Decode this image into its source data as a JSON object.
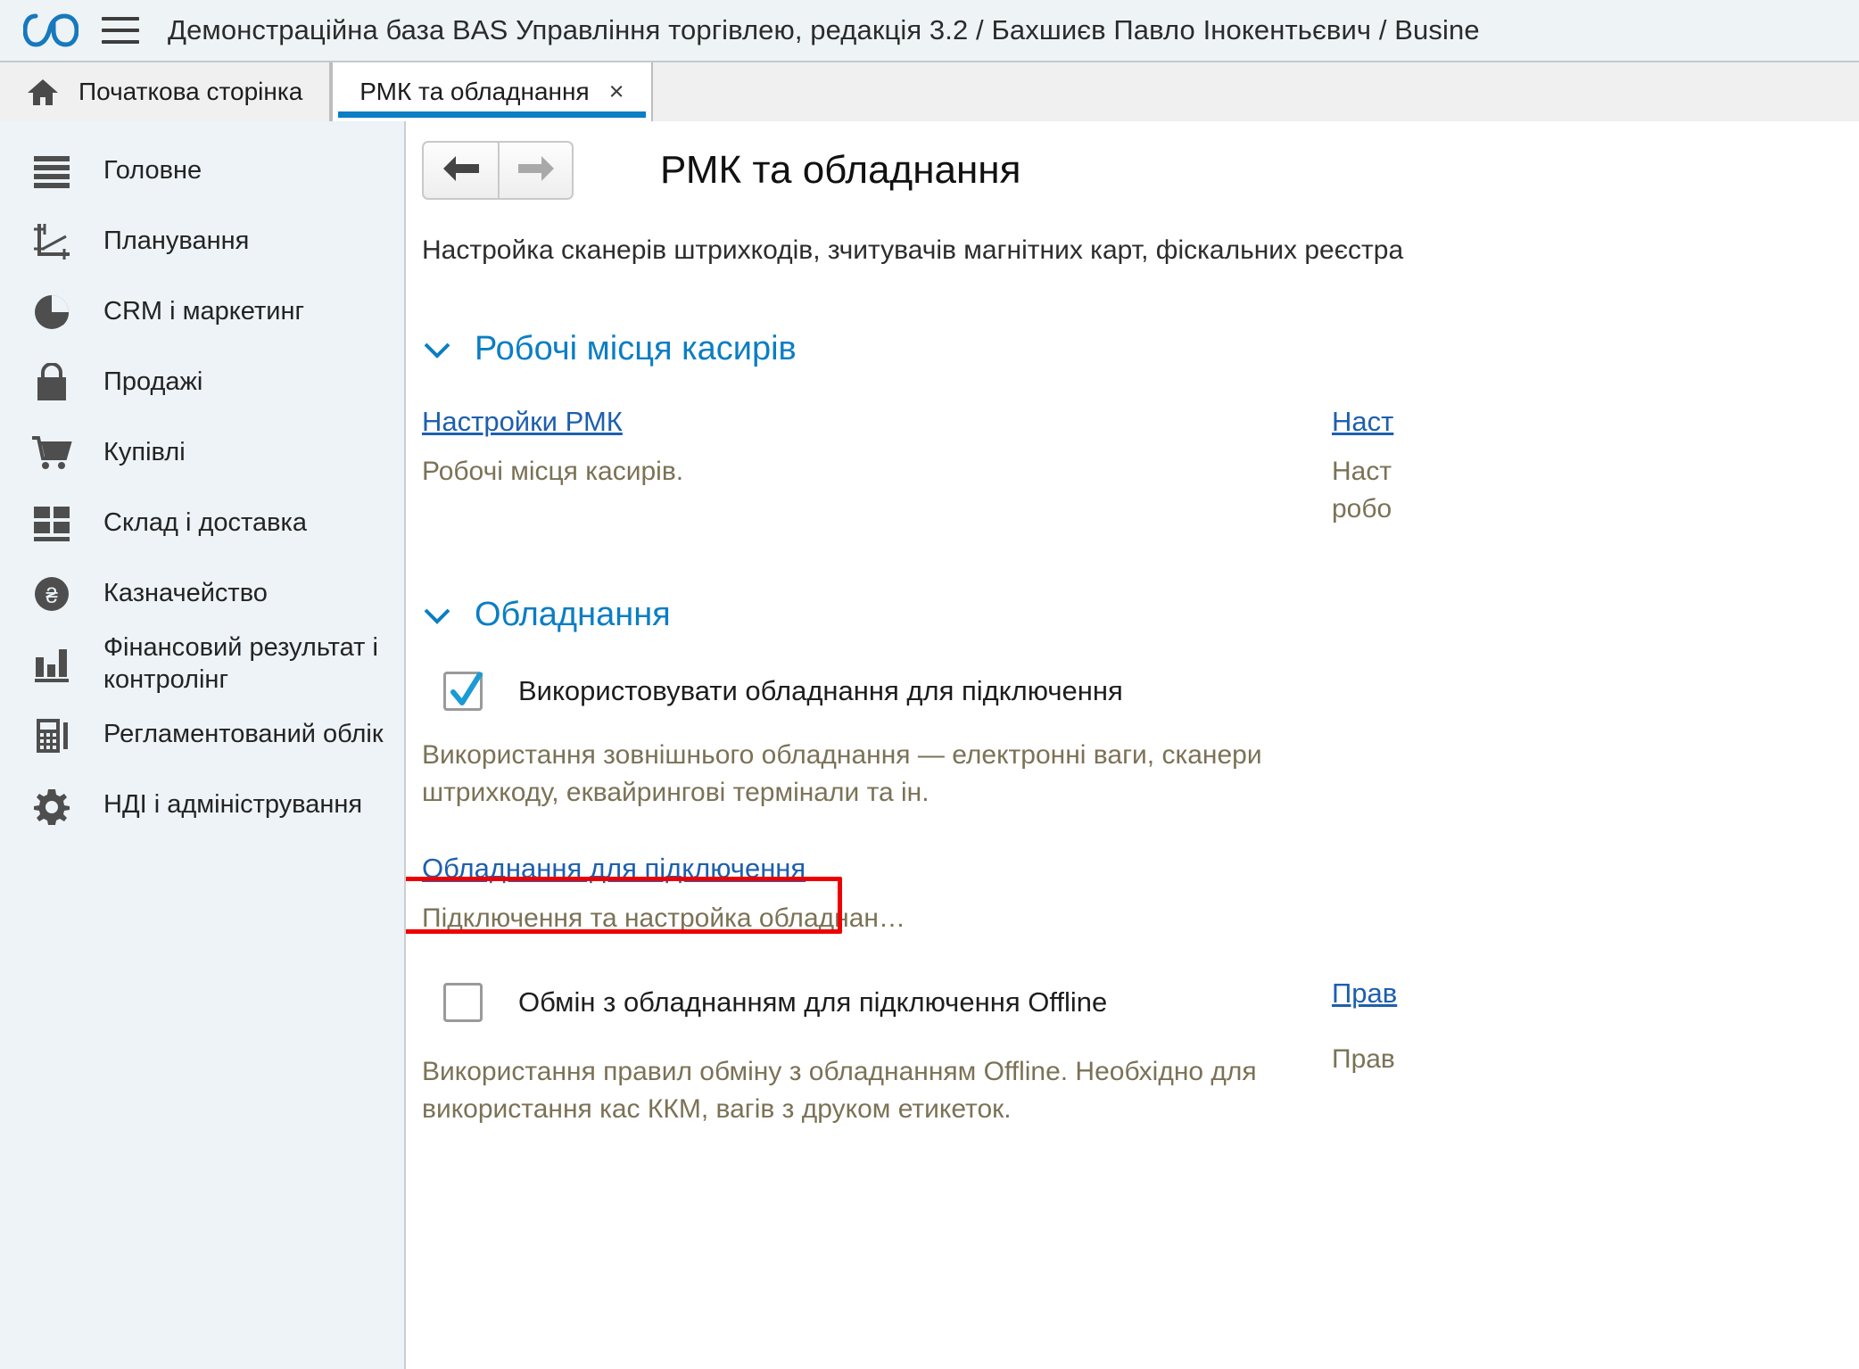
{
  "titlebar": {
    "app_title": "Демонстраційна база BAS Управління торгівлею, редакція 3.2 / Бахшиєв Павло Інокентьєвич / Busine",
    "menu_icon": "hamburger-menu-icon",
    "logo_icon": "bas-logo-icon"
  },
  "tabs": [
    {
      "label": "Початкова сторінка",
      "icon": "home-icon",
      "active": false,
      "closable": false
    },
    {
      "label": "РМК та обладнання",
      "icon": "",
      "active": true,
      "closable": true,
      "close_label": "×"
    }
  ],
  "sidebar": {
    "items": [
      {
        "label": "Головне",
        "icon": "list-lines-icon"
      },
      {
        "label": "Планування",
        "icon": "chart-axes-icon"
      },
      {
        "label": "CRM і маркетинг",
        "icon": "pie-chart-icon"
      },
      {
        "label": "Продажі",
        "icon": "shopping-bag-icon"
      },
      {
        "label": "Купівлі",
        "icon": "shopping-cart-icon"
      },
      {
        "label": "Склад і доставка",
        "icon": "warehouse-grid-icon"
      },
      {
        "label": "Казначейство",
        "icon": "coin-currency-icon"
      },
      {
        "label": "Фінансовий результат і контролінг",
        "icon": "bar-chart-icon"
      },
      {
        "label": "Регламентований облік",
        "icon": "calculator-icon"
      },
      {
        "label": "НДІ і адміністрування",
        "icon": "gear-icon"
      }
    ]
  },
  "main": {
    "nav_back_icon": "arrow-left-icon",
    "nav_forward_icon": "arrow-right-icon",
    "page_title": "РМК та обладнання",
    "page_description": "Настройка сканерів штрихкодів, зчитувачів магнітних карт, фіскальних реєстра",
    "sections": [
      {
        "title": "Робочі місця касирів",
        "chevron_icon": "chevron-down-icon",
        "left": {
          "link": "Настройки РМК",
          "hint": "Робочі місця касирів."
        },
        "right": {
          "link": "Наст",
          "hint_line1": "Наст",
          "hint_line2": "робо"
        }
      },
      {
        "title": "Обладнання",
        "chevron_icon": "chevron-down-icon",
        "checkbox1": {
          "label": "Використовувати обладнання для підключення",
          "checked": true,
          "check_icon": "checkmark-icon"
        },
        "hint1_line1": "Використання зовнішнього обладнання — електронні ваги, сканери",
        "hint1_line2": "штрихкоду, еквайрингові термінали та ін.",
        "link_highlighted": "Обладнання для підключення",
        "hint2": "Підключення та настройка обладнан…",
        "checkbox2": {
          "label": "Обмін з обладнанням для підключення Offline",
          "checked": false
        },
        "right_link2": "Прав",
        "hint3_line1": "Використання правил обміну з обладнанням Offline. Необхідно для",
        "hint3_line2": "використання кас ККМ, вагів з друком етикеток.",
        "right_hint3": "Прав"
      }
    ]
  },
  "colors": {
    "accent_blue": "#0b7ec4",
    "link_blue": "#1d5fae",
    "hint_olive": "#7b7256",
    "highlight_red": "#ee0000",
    "sidebar_bg": "#edf3f6",
    "titlebar_bg": "#eef3f6"
  }
}
